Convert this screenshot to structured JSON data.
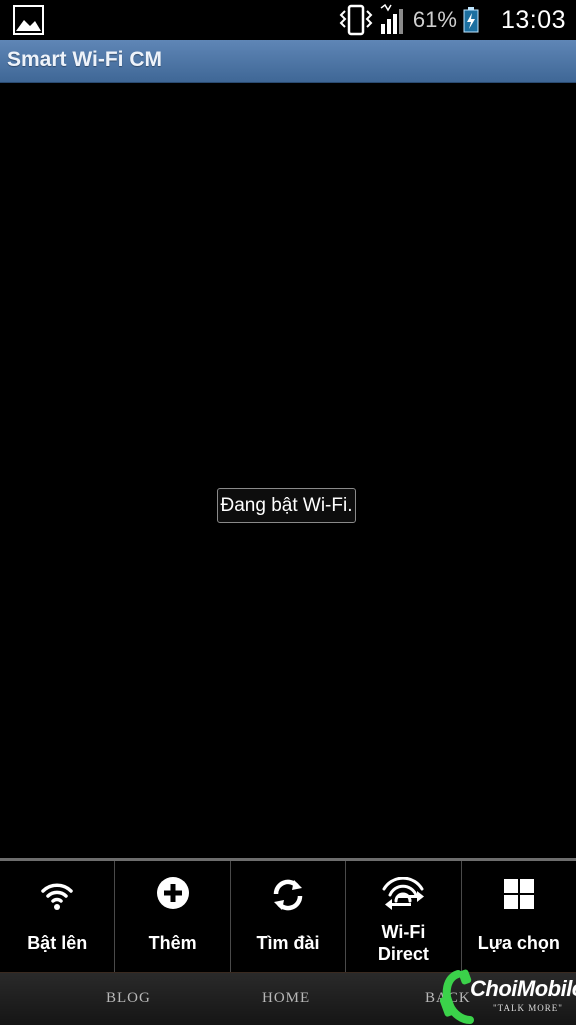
{
  "status_bar": {
    "battery_percent": "61%",
    "time": "13:03",
    "icons": [
      "gallery-notification-icon",
      "vibrate-icon",
      "signal-icon",
      "battery-charging-icon"
    ]
  },
  "app": {
    "title": "Smart Wi-Fi CM"
  },
  "toast": {
    "message": "Đang bật Wi-Fi."
  },
  "menu": {
    "items": [
      {
        "label": "Bật lên",
        "icon": "wifi-icon"
      },
      {
        "label": "Thêm",
        "icon": "add-circle-icon"
      },
      {
        "label": "Tìm đài",
        "icon": "refresh-icon"
      },
      {
        "label": "Wi-Fi\nDirect",
        "icon": "wifi-direct-icon"
      },
      {
        "label": "Lựa chọn",
        "icon": "grid-menu-icon"
      }
    ]
  },
  "blog_nav": {
    "links": [
      "BLOG",
      "HOME",
      "BACK"
    ]
  },
  "watermark": {
    "brand": "ChoiMobile",
    "tagline": "\"TALK MORE\""
  },
  "colors": {
    "titlebar": "#4f77a8",
    "background": "#000000",
    "battery_charging": "#7fd0ff",
    "watermark_green": "#3bd24a"
  }
}
